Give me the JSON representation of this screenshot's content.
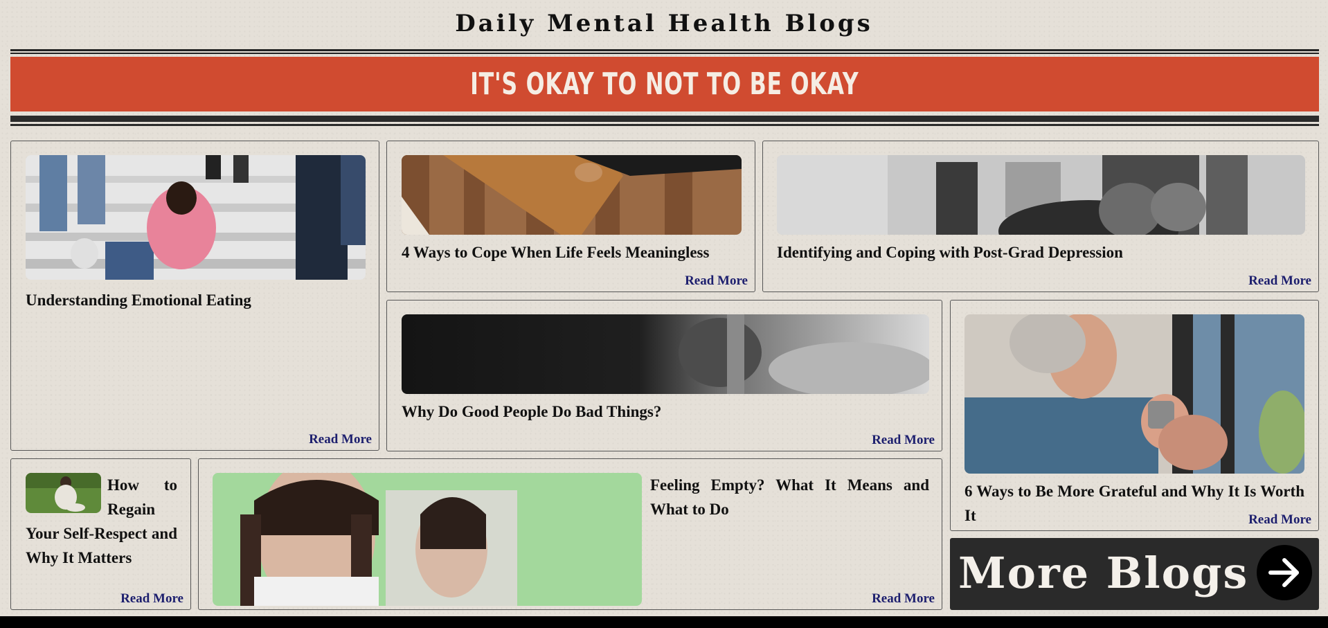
{
  "header": {
    "title": "Daily Mental Health Blogs",
    "banner": "IT'S OKAY TO NOT TO BE OKAY"
  },
  "cards": [
    {
      "title": "Understanding Emotional Eating",
      "read_more": "Read More"
    },
    {
      "title": "4 Ways to Cope When Life Feels Meaningless",
      "read_more": "Read More"
    },
    {
      "title": "Identifying and Coping with Post-Grad Depression",
      "read_more": "Read More"
    },
    {
      "title": "Why Do Good People Do Bad Things?",
      "read_more": "Read More"
    },
    {
      "title": "6 Ways to Be More Grateful and Why It Is Worth It",
      "read_more": "Read More"
    },
    {
      "title": "How to Regain Your Self-Respect and Why It Matters",
      "read_more": "Read More"
    },
    {
      "title": "Feeling Empty? What It Means and What to Do",
      "read_more": "Read More"
    }
  ],
  "more_blogs": {
    "label": "More Blogs",
    "icon": "arrow-right-icon"
  },
  "colors": {
    "background": "#e5e0d8",
    "banner": "#d04b30",
    "link": "#1d1f6e",
    "dark": "#2a2a2a"
  }
}
